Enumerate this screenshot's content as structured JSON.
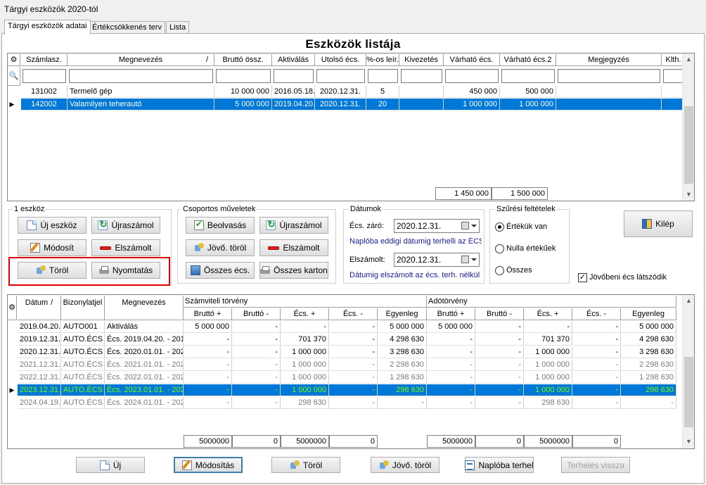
{
  "window": {
    "title": "Tárgyi eszközök 2020-tól"
  },
  "tabs": [
    "Tárgyi eszközök adatai",
    "Értékcsökkenés terv",
    "Lista"
  ],
  "heading": "Eszközök listája",
  "assets": {
    "columns": [
      "Számlasz.",
      "Megnevezés",
      "Bruttó össz.",
      "Aktiválás",
      "Utolsó écs.",
      "%-os leír.",
      "Kivezetés",
      "Várható écs.",
      "Várható écs.2",
      "Megjegyzés",
      "Klth."
    ],
    "sort_marker": "/",
    "rows": [
      [
        "131002",
        "Termelő gép",
        "10 000 000",
        "2016.05.18.",
        "2020.12.31.",
        "5",
        "",
        "450 000",
        "500 000",
        "",
        ""
      ],
      [
        "142002",
        "Valamilyen teherautó",
        "5 000 000",
        "2019.04.20.",
        "2020.12.31.",
        "20",
        "",
        "1 000 000",
        "1 000 000",
        "",
        ""
      ]
    ],
    "totals": {
      "varhato_ecs": "1 450 000",
      "varhato_ecs2": "1 500 000"
    }
  },
  "group_single": {
    "label": "1 eszköz",
    "buttons": {
      "new": "Új eszköz",
      "recalc": "Újraszámol",
      "modify": "Módosít",
      "settled": "Elszámolt",
      "delete": "Töröl",
      "print": "Nyomtatás"
    }
  },
  "group_bulk": {
    "label": "Csoportos műveletek",
    "buttons": {
      "import": "Beolvasás",
      "recalc": "Újraszámol",
      "future_delete": "Jövő. töröl",
      "settled": "Elszámolt",
      "total_ecs": "Összes écs.",
      "total_card": "Összes karton"
    }
  },
  "dates": {
    "label": "Dátumok",
    "ecs_zaro_label": "Écs. záró:",
    "ecs_zaro_value": "2020.12.31.",
    "note1": "Naplóba eddigi dátumig terhelli az ÉCS-t",
    "elszamolt_label": "Elszámolt:",
    "elszamolt_value": "2020.12.31.",
    "note2": "Dátumig elszámolt az écs. terh. nélkül"
  },
  "filters": {
    "label": "Szűrési feltételek",
    "options": [
      "Értékük van",
      "Nulla értékűek",
      "Összes"
    ],
    "selected": 0
  },
  "exit_button": "Kilép",
  "future_checkbox": {
    "label": "Jövőbeni écs látszódik",
    "checked": true
  },
  "ledger": {
    "columns": [
      "Dátum",
      "Bizonylatjel",
      "Megnevezés"
    ],
    "sort_marker": "/",
    "group_szamviteli": "Számviteli törvény",
    "group_ado": "Adótörvény",
    "sub_columns": [
      "Bruttó +",
      "Bruttó -",
      "Écs. +",
      "Écs. -",
      "Egyenleg"
    ],
    "rows": [
      {
        "style": "normal",
        "cells": [
          "2019.04.20.",
          "AUTO001",
          "Aktiválás",
          "5 000 000",
          "-",
          "-",
          "-",
          "5 000 000",
          "5 000 000",
          "-",
          "-",
          "-",
          "5 000 000"
        ]
      },
      {
        "style": "normal",
        "cells": [
          "2019.12.31.",
          "AUTO.ÉCS",
          "Écs. 2019.04.20. - 201",
          "-",
          "-",
          "701 370",
          "-",
          "4 298 630",
          "-",
          "-",
          "701 370",
          "-",
          "4 298 630"
        ]
      },
      {
        "style": "normal",
        "cells": [
          "2020.12.31.",
          "AUTO.ÉCS",
          "Écs. 2020.01.01. - 202",
          "-",
          "-",
          "1 000 000",
          "-",
          "3 298 630",
          "-",
          "-",
          "1 000 000",
          "-",
          "3 298 630"
        ]
      },
      {
        "style": "grey",
        "cells": [
          "2021.12.31.",
          "AUTO.ÉCS",
          "Écs. 2021.01.01. - 202",
          "-",
          "-",
          "1 000 000",
          "-",
          "2 298 630",
          "-",
          "-",
          "1 000 000",
          "-",
          "2 298 630"
        ]
      },
      {
        "style": "grey",
        "cells": [
          "2022.12.31.",
          "AUTO.ÉCS",
          "Écs. 2022.01.01. - 202",
          "-",
          "-",
          "1 000 000",
          "-",
          "1 298 630",
          "-",
          "-",
          "1 000 000",
          "-",
          "1 298 630"
        ]
      },
      {
        "style": "selected",
        "cells": [
          "2023.12.31.",
          "AUTO.ÉCS",
          "Écs. 2023.01.01. - 202",
          "-",
          "-",
          "1 000 000",
          "-",
          "298 630",
          "-",
          "-",
          "1 000 000",
          "-",
          "298 630"
        ]
      },
      {
        "style": "grey",
        "cells": [
          "2024.04.19.",
          "AUTO.ÉCS",
          "Écs. 2024.01.01. - 202",
          "-",
          "-",
          "298 630",
          "-",
          "-",
          "-",
          "-",
          "298 630",
          "-",
          "-"
        ]
      }
    ],
    "totals": [
      "5000000",
      "0",
      "5000000",
      "0",
      "5000000",
      "0",
      "5000000",
      "0"
    ]
  },
  "bottom_buttons": {
    "new": "Új",
    "modify": "Módosítás",
    "delete": "Töröl",
    "future_delete": "Jövő. töröl",
    "journal": "Naplóba terhel",
    "undo": "Terhelés vissza"
  }
}
